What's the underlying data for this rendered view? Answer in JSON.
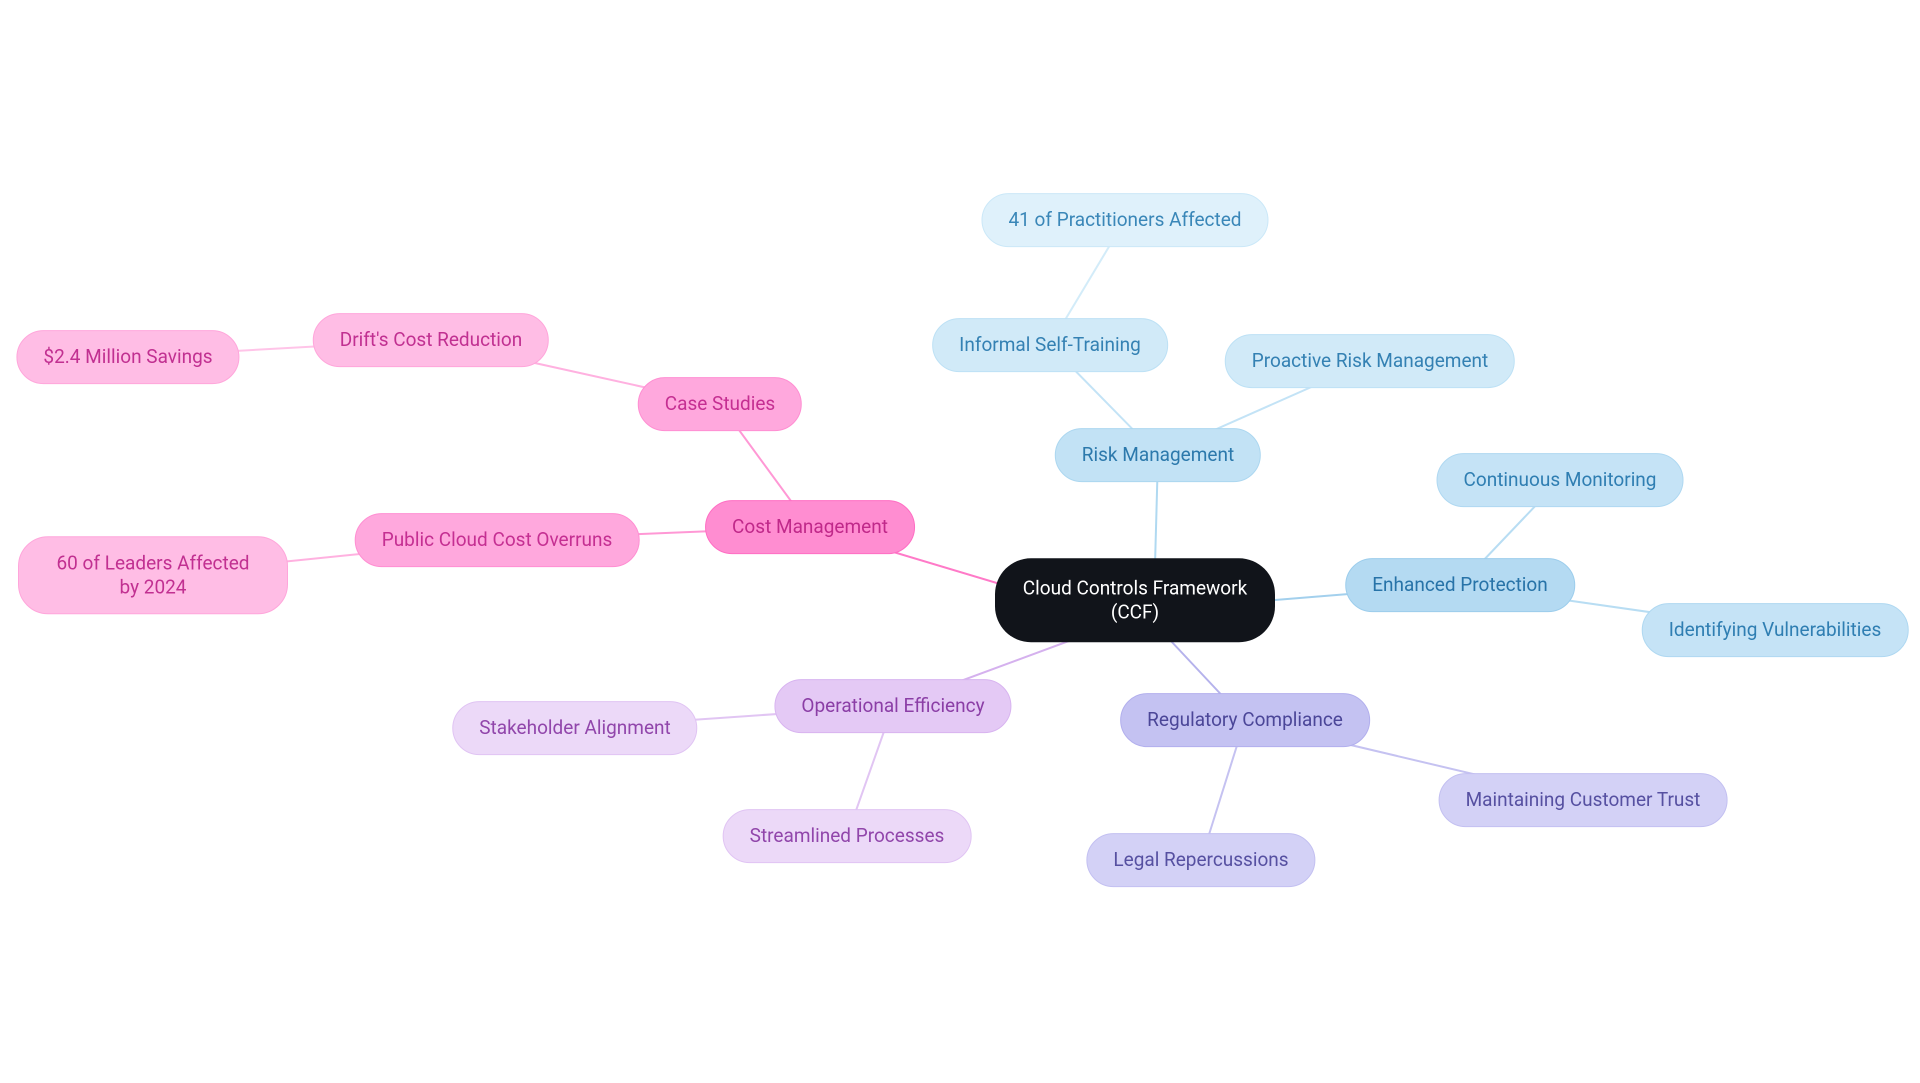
{
  "root": {
    "label": "Cloud Controls Framework (CCF)"
  },
  "cost": {
    "label": "Cost Management",
    "caseStudies": {
      "label": "Case Studies"
    },
    "drift": {
      "label": "Drift's Cost Reduction"
    },
    "savings": {
      "label": "$2.4 Million Savings"
    },
    "overruns": {
      "label": "Public Cloud Cost Overruns"
    },
    "leaders": {
      "label": "60 of Leaders Affected by 2024"
    }
  },
  "ops": {
    "label": "Operational Efficiency",
    "stakeholder": {
      "label": "Stakeholder Alignment"
    },
    "streamlined": {
      "label": "Streamlined Processes"
    }
  },
  "reg": {
    "label": "Regulatory Compliance",
    "legal": {
      "label": "Legal Repercussions"
    },
    "trust": {
      "label": "Maintaining Customer Trust"
    }
  },
  "protect": {
    "label": "Enhanced Protection",
    "monitor": {
      "label": "Continuous Monitoring"
    },
    "vuln": {
      "label": "Identifying Vulnerabilities"
    }
  },
  "risk": {
    "label": "Risk Management",
    "proactive": {
      "label": "Proactive Risk Management"
    },
    "selftrain": {
      "label": "Informal Self-Training"
    },
    "practitioners": {
      "label": "41 of Practitioners Affected"
    }
  },
  "colors": {
    "pinkEdge": "#ff7ac8",
    "lilacEdge": "#d5b1ee",
    "indigoEdge": "#b5b2ec",
    "blueEdge": "#a3d0ed",
    "lblueEdge": "#b0d9f1"
  }
}
